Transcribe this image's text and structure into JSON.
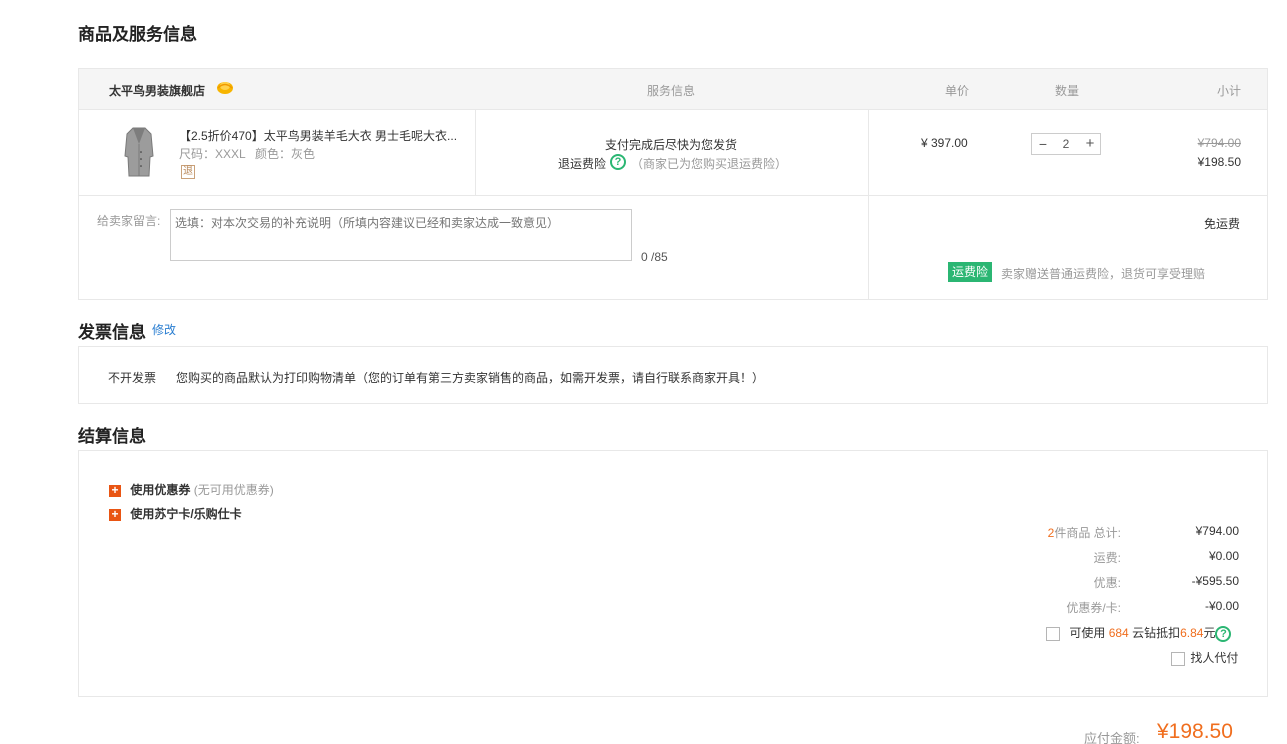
{
  "goods_section": {
    "title": "商品及服务信息",
    "shop_name": "太平鸟男装旗舰店",
    "headers": {
      "service": "服务信息",
      "unit_price": "单价",
      "quantity": "数量",
      "subtotal": "小计"
    },
    "product": {
      "name": "【2.5折价470】太平鸟男装羊毛大衣 男士毛呢大衣...",
      "size": "尺码：XXXL",
      "color": "颜色：灰色",
      "return_badge": "退",
      "service_line1": "支付完成后尽快为您发货",
      "service_insurance": "退运费险",
      "service_insurance_note": "（商家已为您购买退运费险）",
      "unit_price": "¥ 397.00",
      "quantity": "2",
      "minus": "−",
      "plus": "+",
      "original_subtotal": "¥794.00",
      "subtotal": "¥198.50"
    },
    "message": {
      "label": "给卖家留言:",
      "placeholder": "选填：对本次交易的补充说明（所填内容建议已经和卖家达成一致意见）",
      "counter": "0 /85"
    },
    "shipping": {
      "free_label": "免运费",
      "insurance_tag": "运费险",
      "insurance_text": "卖家赠送普通运费险，退货可享受理赔"
    }
  },
  "invoice_section": {
    "title": "发票信息",
    "edit_link": "修改",
    "type": "不开发票",
    "note": "您购买的商品默认为打印购物清单（您的订单有第三方卖家销售的商品，如需开发票，请自行联系商家开具！）"
  },
  "settlement_section": {
    "title": "结算信息",
    "coupon_label": "使用优惠券",
    "coupon_note": "(无可用优惠券)",
    "card_label": "使用苏宁卡/乐购仕卡",
    "items_count": "2",
    "items_total_label": "件商品 总计:",
    "items_total": "¥794.00",
    "shipping_label": "运费:",
    "shipping_value": "¥0.00",
    "discount_label": "优惠:",
    "discount_value": "-¥595.50",
    "coupon_card_label": "优惠券/卡:",
    "coupon_card_value": "-¥0.00",
    "yunzuan_pre": "可使用",
    "yunzuan_amount": "684",
    "yunzuan_mid": "云钻抵扣",
    "yunzuan_value": "6.84",
    "yunzuan_unit": "元",
    "proxy_pay": "找人代付",
    "payable_label": "应付金额:",
    "payable_value": "¥198.50"
  },
  "colors": {
    "accent": "#f06e1e",
    "green": "#2bb673",
    "link": "#2a7ed1",
    "plus_orange": "#e95513"
  },
  "icons": {
    "shop_badge": "shop-badge-icon",
    "help": "question-icon",
    "expand": "plus-icon"
  }
}
